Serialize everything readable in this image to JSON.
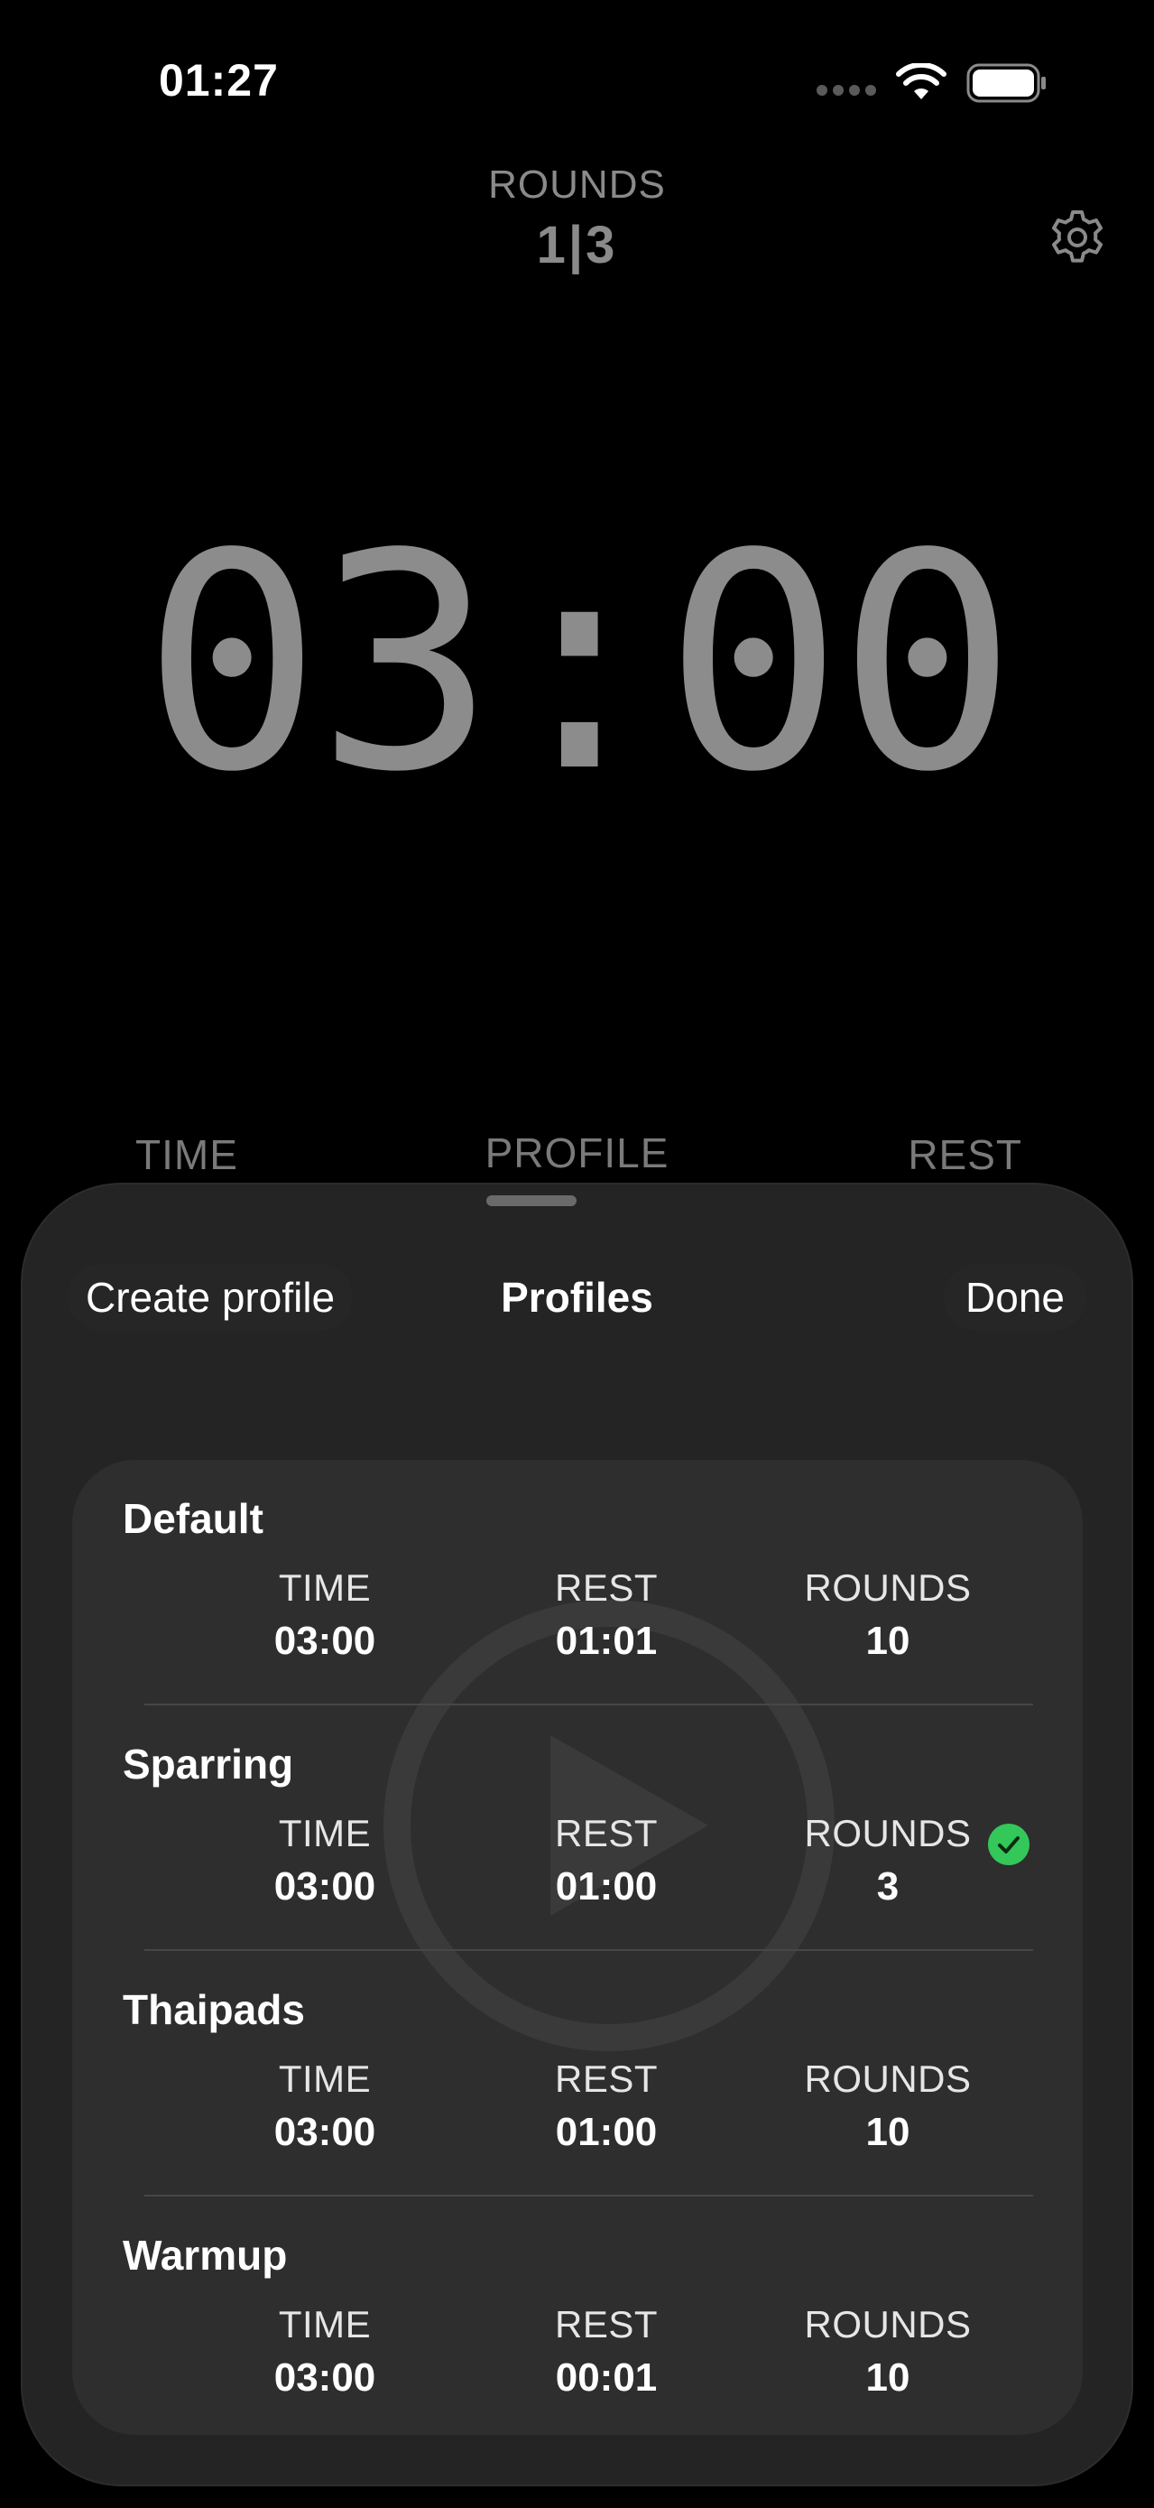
{
  "status_bar": {
    "time": "01:27"
  },
  "timer_screen": {
    "rounds_label": "ROUNDS",
    "rounds_value": "1|3",
    "timer": "03:00",
    "bottom_labels": {
      "time": "TIME",
      "profile": "PROFILE",
      "rest": "REST"
    }
  },
  "sheet": {
    "create_label": "Create profile",
    "title": "Profiles",
    "done_label": "Done",
    "labels": {
      "time": "TIME",
      "rest": "REST",
      "rounds": "ROUNDS"
    },
    "profiles": [
      {
        "name": "Default",
        "time": "03:00",
        "rest": "01:01",
        "rounds": "10",
        "selected": false
      },
      {
        "name": "Sparring",
        "time": "03:00",
        "rest": "01:00",
        "rounds": "3",
        "selected": true
      },
      {
        "name": "Thaipads",
        "time": "03:00",
        "rest": "01:00",
        "rounds": "10",
        "selected": false
      },
      {
        "name": "Warmup",
        "time": "03:00",
        "rest": "00:01",
        "rounds": "10",
        "selected": false
      }
    ]
  },
  "colors": {
    "background": "#000000",
    "sheet": "#242424",
    "card": "#2e2e2e",
    "selected_check": "#34c759",
    "dim_text": "#8a8a8a"
  },
  "icons": {
    "settings": "gear-icon",
    "selected": "checkmark-circle-icon",
    "wifi": "wifi-icon",
    "battery": "battery-icon",
    "signal": "signal-dots-icon",
    "play": "play-icon"
  }
}
